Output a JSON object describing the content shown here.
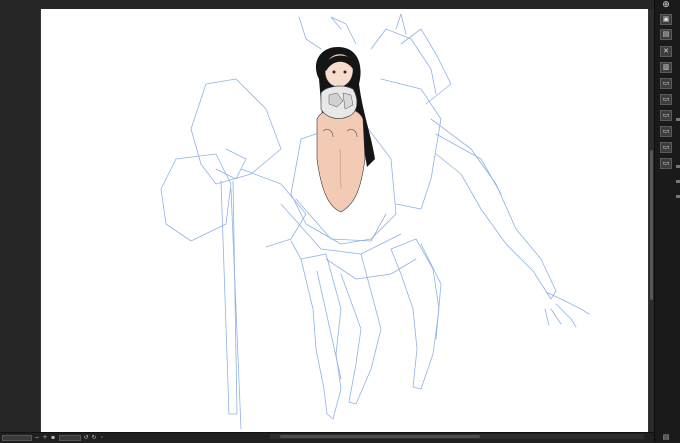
{
  "window": {
    "title": ""
  },
  "canvas": {
    "background": "#ffffff",
    "sketch_color": "#8fb2e3",
    "skin_color": "#f3cbb4",
    "hair_color": "#151515"
  },
  "right_toolbar": {
    "items": [
      {
        "name": "search-icon",
        "glyph": "⊕"
      },
      {
        "name": "layer-panel-icon",
        "glyph": "▣"
      },
      {
        "name": "layer-settings-icon",
        "glyph": "▤"
      },
      {
        "name": "delete-layer-icon",
        "glyph": "✕"
      },
      {
        "name": "layer-icon-4",
        "glyph": "▥"
      },
      {
        "name": "layer-icon-5",
        "glyph": "▭"
      },
      {
        "name": "layer-icon-6",
        "glyph": "▭"
      },
      {
        "name": "layer-icon-7",
        "glyph": "▭"
      },
      {
        "name": "layer-icon-8",
        "glyph": "▭"
      },
      {
        "name": "layer-icon-9",
        "glyph": "▭"
      },
      {
        "name": "layer-icon-10",
        "glyph": "▭"
      },
      {
        "name": "layer-icon-11",
        "glyph": "▭"
      },
      {
        "name": "layer-icon-12",
        "glyph": "▤"
      }
    ]
  },
  "status_bar": {
    "zoom_value": "",
    "angle_value": ""
  }
}
